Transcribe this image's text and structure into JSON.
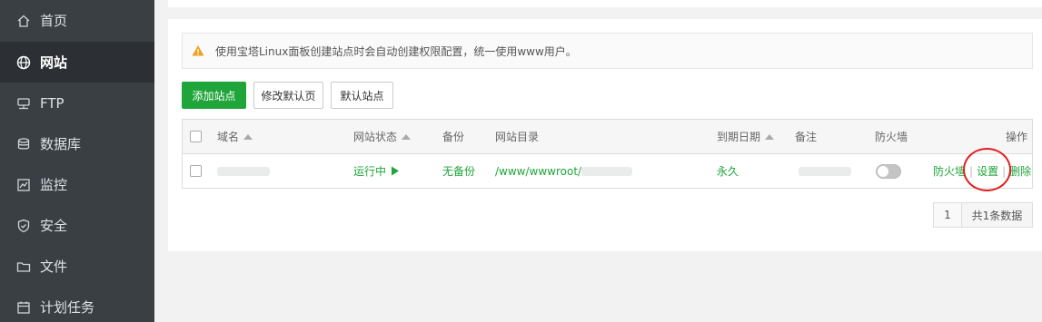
{
  "sidebar": {
    "items": [
      {
        "label": "首页",
        "icon": "home-icon",
        "active": false
      },
      {
        "label": "网站",
        "icon": "globe-icon",
        "active": true
      },
      {
        "label": "FTP",
        "icon": "ftp-icon",
        "active": false
      },
      {
        "label": "数据库",
        "icon": "database-icon",
        "active": false
      },
      {
        "label": "监控",
        "icon": "monitor-chart-icon",
        "active": false
      },
      {
        "label": "安全",
        "icon": "shield-icon",
        "active": false
      },
      {
        "label": "文件",
        "icon": "folder-icon",
        "active": false
      },
      {
        "label": "计划任务",
        "icon": "calendar-icon",
        "active": false
      }
    ]
  },
  "notice": {
    "icon": "warning-icon",
    "text": "使用宝塔Linux面板创建站点时会自动创建权限配置，统一使用www用户。"
  },
  "toolbar": {
    "add_site": "添加站点",
    "edit_default_page": "修改默认页",
    "default_site": "默认站点"
  },
  "table": {
    "headers": {
      "domain": "域名",
      "status": "网站状态",
      "backup": "备份",
      "directory": "网站目录",
      "expiry": "到期日期",
      "note": "备注",
      "firewall": "防火墙",
      "actions": "操作"
    },
    "rows": [
      {
        "status": "运行中",
        "backup": "无备份",
        "directory": "/www/wwwroot/",
        "expiry": "永久",
        "firewall_enabled": false,
        "action_firewall": "防火墙",
        "action_settings": "设置",
        "action_delete": "删除"
      }
    ]
  },
  "pagination": {
    "page": "1",
    "total": "共1条数据"
  },
  "colors": {
    "accent": "#20a53a",
    "sidebar_bg": "#3a3f44",
    "highlight_circle": "#e02020"
  }
}
